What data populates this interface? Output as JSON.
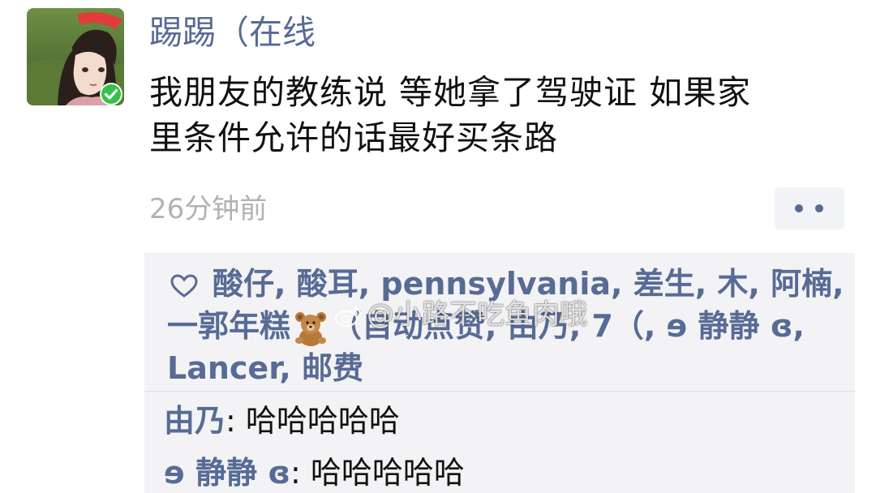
{
  "post": {
    "username": "踢踢（在线",
    "text_line1": "我朋友的教练说 等她拿了驾驶证 如果家",
    "text_line2": "里条件允许的话最好买条路",
    "timestamp": "26分钟前"
  },
  "likes": {
    "line1": [
      {
        "name": "酸仔",
        "sep": ", "
      },
      {
        "name": "酸耳",
        "sep": ", "
      },
      {
        "name": "pennsylvania",
        "sep": ", "
      },
      {
        "name": "差生",
        "sep": ", "
      },
      {
        "name": "木",
        "sep": ", "
      },
      {
        "name": "阿楠",
        "sep": ","
      }
    ],
    "line2_name1": "一郭年糕",
    "line2_name1_sep": "",
    "line2_name2": "（自动点赞",
    "line2_name2_sep": ", ",
    "line2_name3": "由乃",
    "line2_name3_sep": ", ",
    "line2_name4": "7（",
    "line2_name4_sep": ", ",
    "line2_name5": "ɘ 静静 ɞ",
    "line2_name5_sep": ",",
    "line3_name1": "Lancer",
    "line3_name1_sep": ", ",
    "line3_name2": "邮费"
  },
  "comments": [
    {
      "author": "由乃",
      "colon": ": ",
      "text": "哈哈哈哈哈"
    },
    {
      "author": "ɘ 静静 ɞ",
      "colon": ": ",
      "text": "哈哈哈哈哈"
    }
  ],
  "watermark": {
    "text": "@小路不吃鱼肉哦"
  },
  "colors": {
    "link": "#576b95",
    "text": "#111111",
    "timestamp": "#b2b2b2",
    "panel": "#f3f3f5",
    "online_badge": "#35c24a"
  },
  "icons": {
    "heart": "heart-outline-icon",
    "bear": "teddy-bear-emoji-icon",
    "online": "online-check-icon",
    "more": "more-dots-icon",
    "weibo": "weibo-logo-icon"
  }
}
